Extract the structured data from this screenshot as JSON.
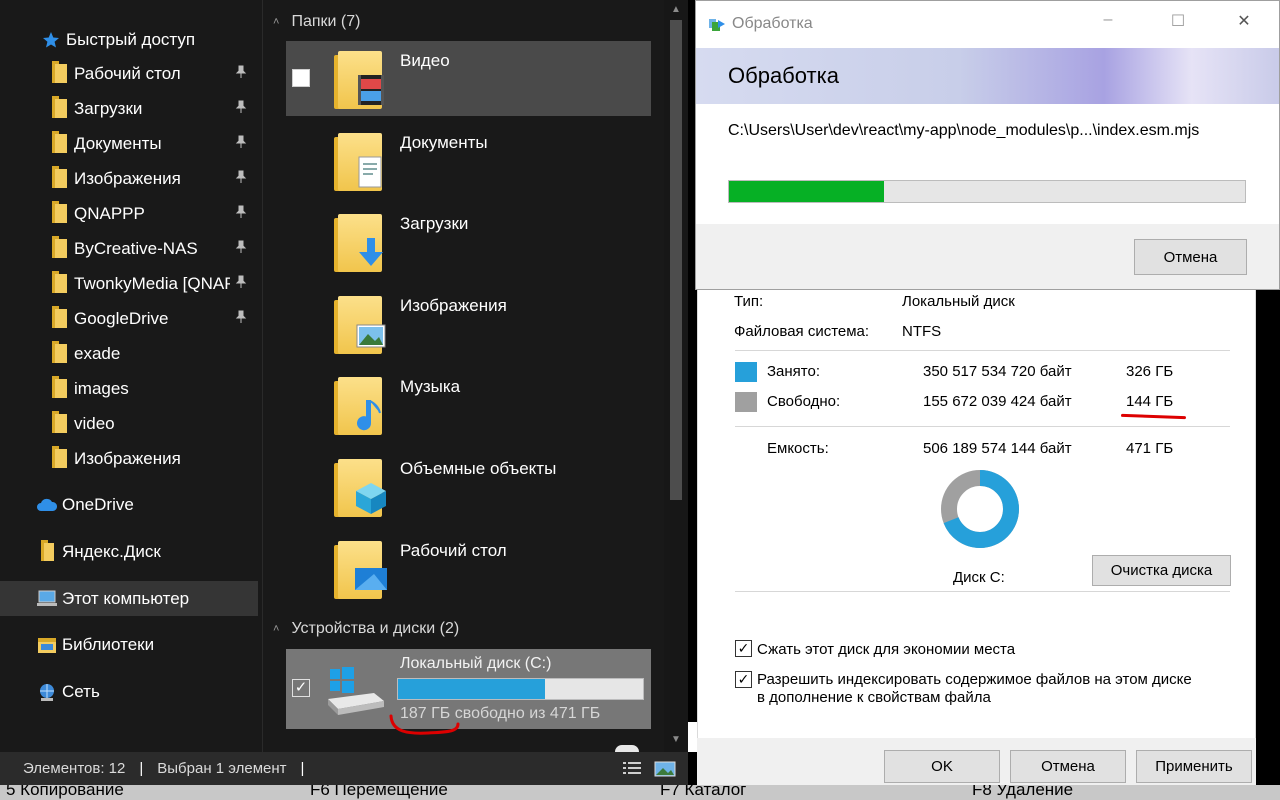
{
  "explorer": {
    "nav": {
      "quick_access": "Быстрый доступ",
      "items": [
        {
          "label": "Рабочий стол",
          "pinned": true
        },
        {
          "label": "Загрузки",
          "pinned": true
        },
        {
          "label": "Документы",
          "pinned": true
        },
        {
          "label": "Изображения",
          "pinned": true
        },
        {
          "label": "QNAPPP",
          "pinned": true
        },
        {
          "label": "ByCreative-NAS",
          "pinned": true
        },
        {
          "label": "TwonkyMedia [QNAP",
          "pinned": true
        },
        {
          "label": "GoogleDrive",
          "pinned": true
        },
        {
          "label": "exade",
          "pinned": false
        },
        {
          "label": "images",
          "pinned": false
        },
        {
          "label": "video",
          "pinned": false
        },
        {
          "label": "Изображения",
          "pinned": false
        }
      ],
      "onedrive": "OneDrive",
      "yandex": "Яндекс.Диск",
      "this_pc": "Этот компьютер",
      "libraries": "Библиотеки",
      "network": "Сеть"
    },
    "folders_group": "Папки (7)",
    "folders": [
      {
        "name": "Видео"
      },
      {
        "name": "Документы"
      },
      {
        "name": "Загрузки"
      },
      {
        "name": "Изображения"
      },
      {
        "name": "Музыка"
      },
      {
        "name": "Объемные объекты"
      },
      {
        "name": "Рабочий стол"
      }
    ],
    "devices_group": "Устройства и диски (2)",
    "drive": {
      "name": "Локальный диск (C:)",
      "used_fraction": 0.6,
      "free_text": "187 ГБ свободно из 471 ГБ"
    },
    "status": {
      "items": "Элементов: 12",
      "selected": "Выбран 1 элемент"
    }
  },
  "function_keys": [
    "5 Копирование",
    "F6 Перемещение",
    "F7 Каталог",
    "F8 Удаление"
  ],
  "dialog": {
    "title": "Обработка",
    "heading": "Обработка",
    "path": "C:\\Users\\User\\dev\\react\\my-app\\node_modules\\p...\\index.esm.mjs",
    "progress": 0.3,
    "cancel": "Отмена"
  },
  "properties": {
    "type_label": "Тип:",
    "type_value": "Локальный диск",
    "fs_label": "Файловая система:",
    "fs_value": "NTFS",
    "used_label": "Занято:",
    "used_bytes": "350 517 534 720 байт",
    "used_gb": "326 ГБ",
    "free_label": "Свободно:",
    "free_bytes": "155 672 039 424 байт",
    "free_gb": "144 ГБ",
    "capacity_label": "Емкость:",
    "capacity_bytes": "506 189 574 144 байт",
    "capacity_gb": "471 ГБ",
    "used_fraction": 0.69,
    "disk_label": "Диск C:",
    "cleanup": "Очистка диска",
    "compress": "Сжать этот диск для экономии места",
    "index_line1": "Разрешить индексировать содержимое файлов на этом диске",
    "index_line2": "в дополнение к свойствам файла",
    "ok": "OK",
    "cancel": "Отмена",
    "apply": "Применить",
    "colors": {
      "used": "#26a0da",
      "free": "#a0a0a0"
    }
  }
}
